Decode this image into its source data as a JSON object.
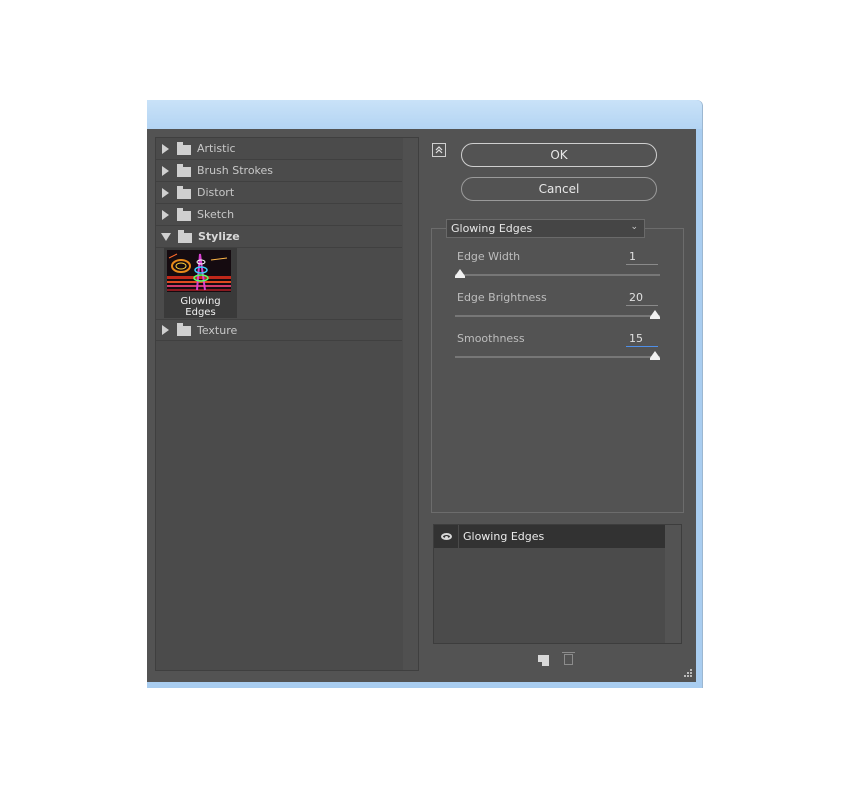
{
  "filter_tree": {
    "categories": [
      {
        "label": "Artistic",
        "expanded": false
      },
      {
        "label": "Brush Strokes",
        "expanded": false
      },
      {
        "label": "Distort",
        "expanded": false
      },
      {
        "label": "Sketch",
        "expanded": false
      },
      {
        "label": "Stylize",
        "expanded": true
      },
      {
        "label": "Texture",
        "expanded": false
      }
    ],
    "stylize_items": [
      {
        "label": "Glowing Edges",
        "selected": true
      }
    ]
  },
  "buttons": {
    "ok": "OK",
    "cancel": "Cancel"
  },
  "filter_select": {
    "value": "Glowing Edges"
  },
  "params": [
    {
      "label": "Edge Width",
      "value": "1",
      "min": 1,
      "max": 14,
      "level": 1
    },
    {
      "label": "Edge Brightness",
      "value": "20",
      "min": 0,
      "max": 20,
      "level": 20
    },
    {
      "label": "Smoothness",
      "value": "15",
      "min": 1,
      "max": 15,
      "level": 15
    }
  ],
  "effect_layers": [
    {
      "label": "Glowing Edges",
      "visible": true
    }
  ],
  "icons": {
    "collapse": "collapse-chevrons-icon",
    "visibility": "eye-icon",
    "new_layer": "new-effect-layer-icon",
    "delete_layer": "trash-icon",
    "resize": "resize-grip-icon"
  },
  "colors": {
    "panel_bg": "#535353",
    "list_bg": "#4b4b4b",
    "title_bar": "#b3d4f3",
    "active_field_underline": "#4f8fe8"
  }
}
